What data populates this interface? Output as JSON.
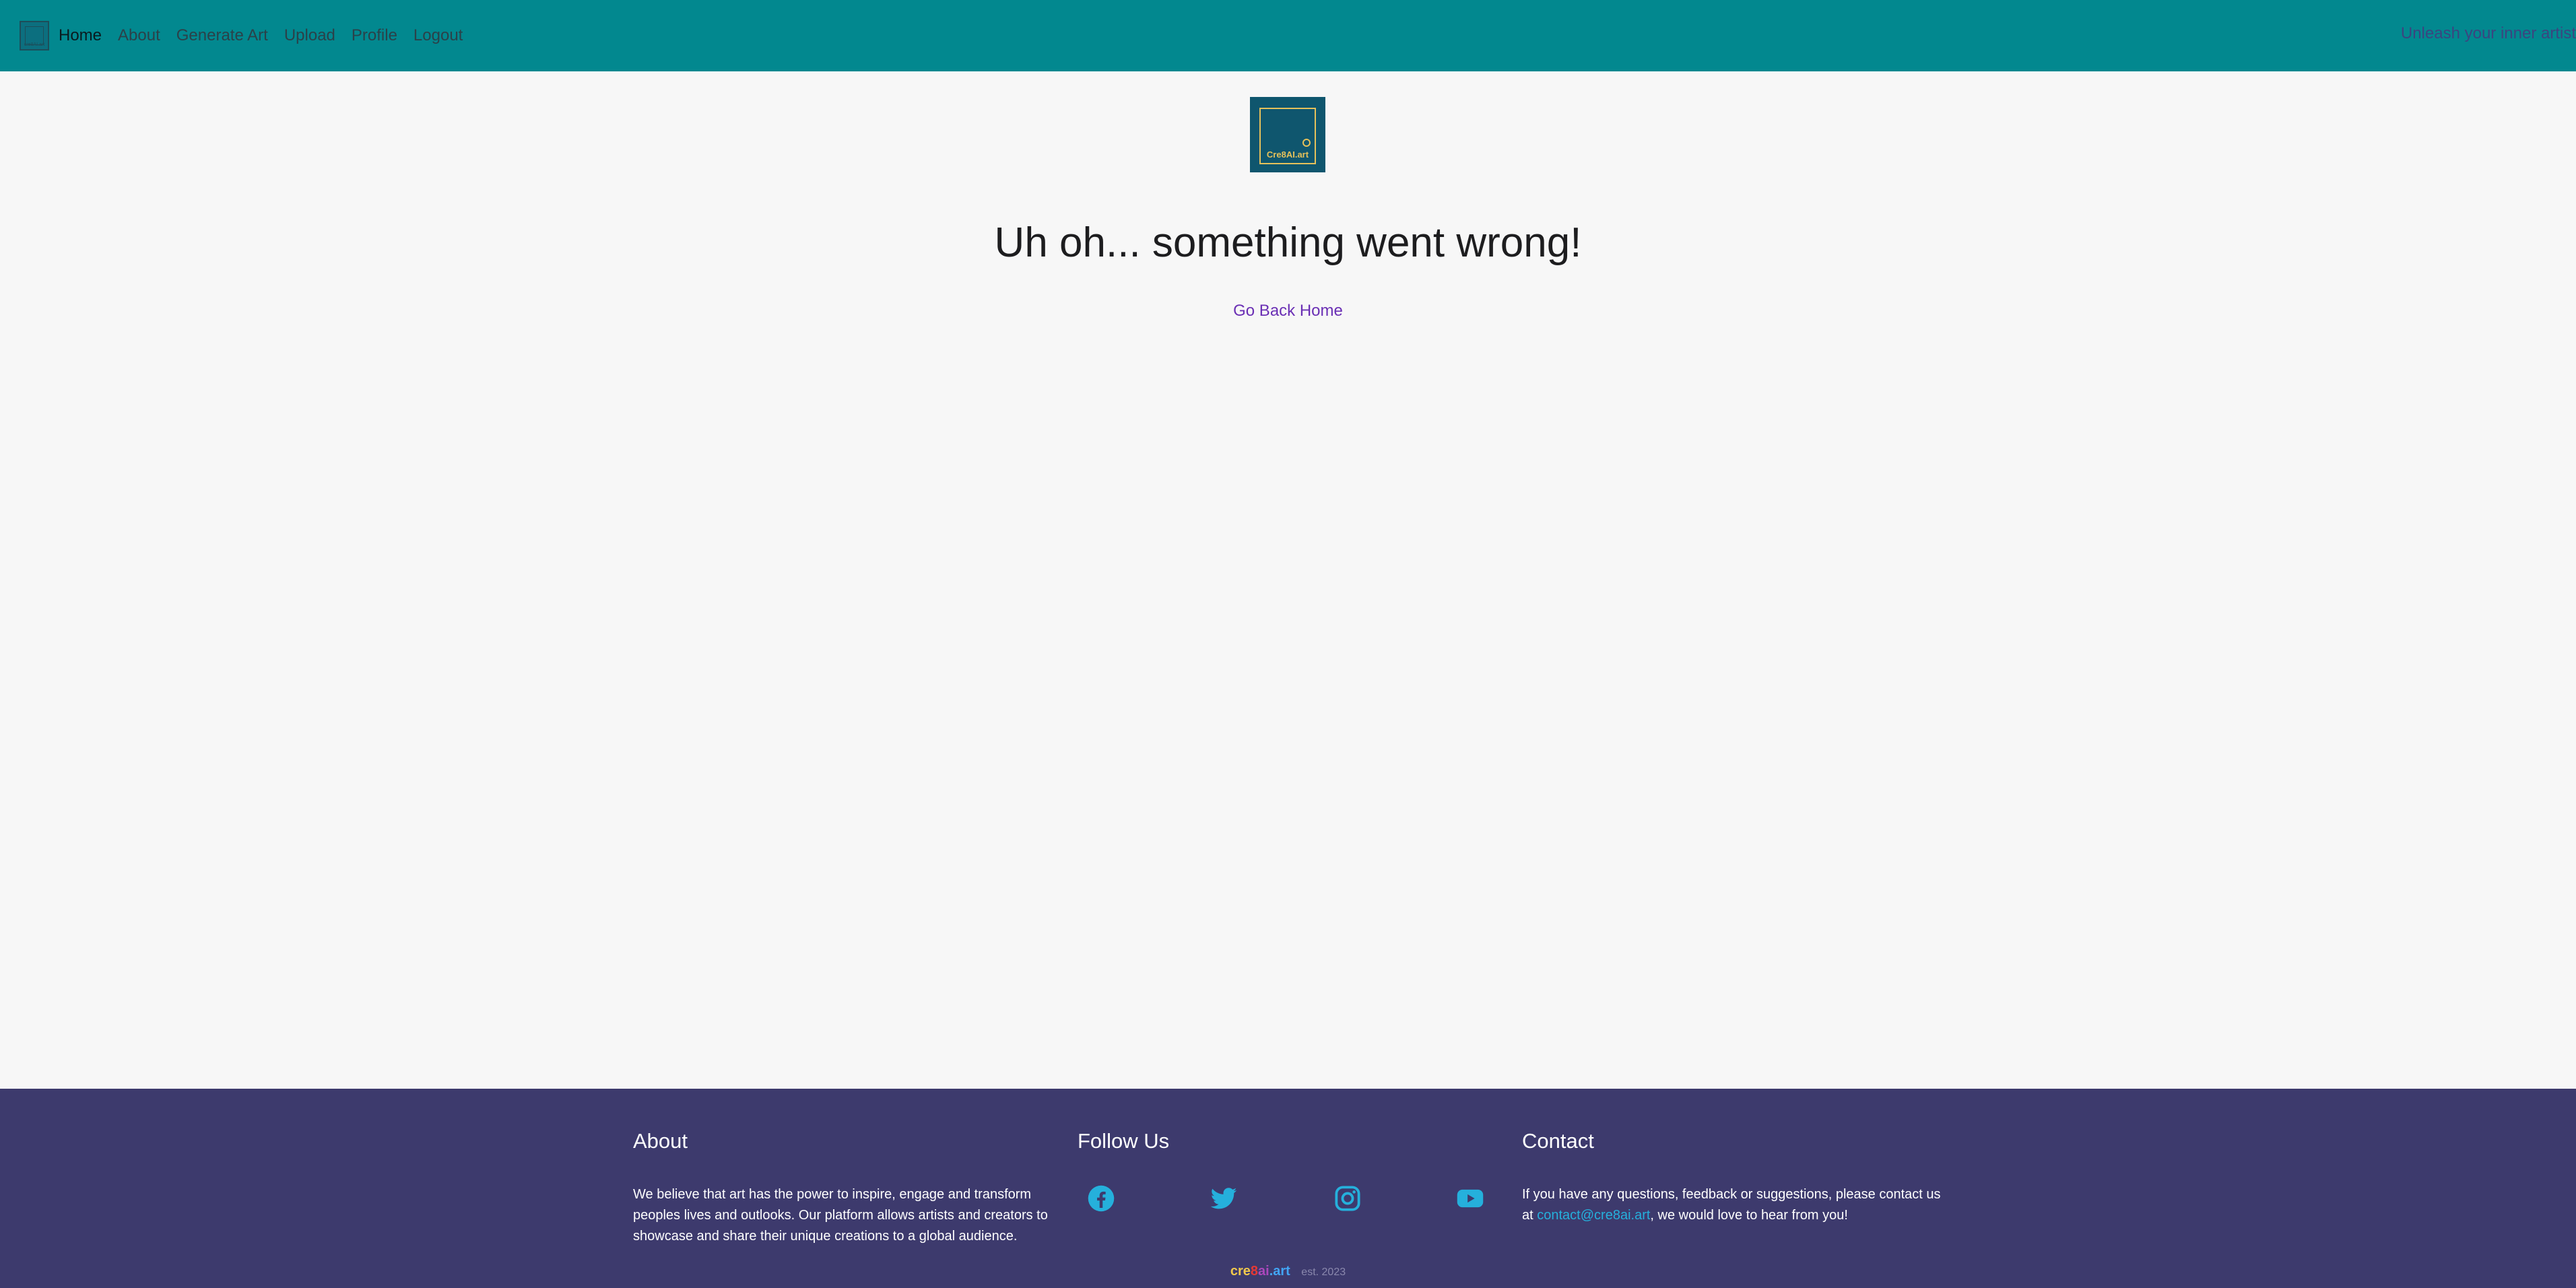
{
  "navbar": {
    "logo_text": "cre8AI.art",
    "links": [
      {
        "label": "Home",
        "active": true
      },
      {
        "label": "About"
      },
      {
        "label": "Generate Art"
      },
      {
        "label": "Upload"
      },
      {
        "label": "Profile"
      },
      {
        "label": "Logout"
      }
    ],
    "tagline": "Unleash your inner artist"
  },
  "main": {
    "logo_text": "Cre8AI.art",
    "heading": "Uh oh... something went wrong!",
    "home_link": "Go Back Home"
  },
  "footer": {
    "about": {
      "title": "About",
      "text": "We believe that art has the power to inspire, engage and transform peoples lives and outlooks. Our platform allows artists and creators to showcase and share their unique creations to a global audience."
    },
    "follow": {
      "title": "Follow Us",
      "icons": [
        "facebook-icon",
        "twitter-icon",
        "instagram-icon",
        "youtube-icon"
      ]
    },
    "contact": {
      "title": "Contact",
      "text_before": "If you have any questions, feedback or suggestions, please contact us at ",
      "email": "contact@cre8ai.art",
      "text_after": ", we would love to hear from you!"
    },
    "brand": {
      "p1": "cre",
      "p2": "8",
      "p3": "ai",
      "p4": ".art"
    },
    "established": "est. 2023"
  },
  "colors": {
    "navbar": "#02888f",
    "footer": "#3d3a6d",
    "link": "#6a2fb4",
    "accent": "#25b0dc"
  }
}
